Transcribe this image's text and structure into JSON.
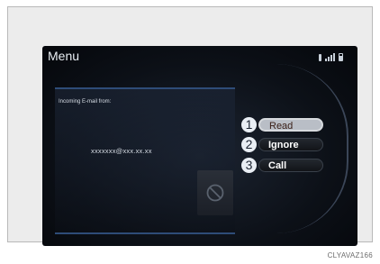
{
  "menu": {
    "title": "Menu"
  },
  "status_icons": [
    "bluetooth-icon",
    "signal-icon",
    "battery-icon"
  ],
  "notification": {
    "label": "Incoming E-mail from:",
    "sender": "xxxxxxx@xxx.xx.xx"
  },
  "options": [
    {
      "number": "1",
      "label": "Read"
    },
    {
      "number": "2",
      "label": "Ignore"
    },
    {
      "number": "3",
      "label": "Call"
    }
  ],
  "caption": "CLYAVAZ166"
}
